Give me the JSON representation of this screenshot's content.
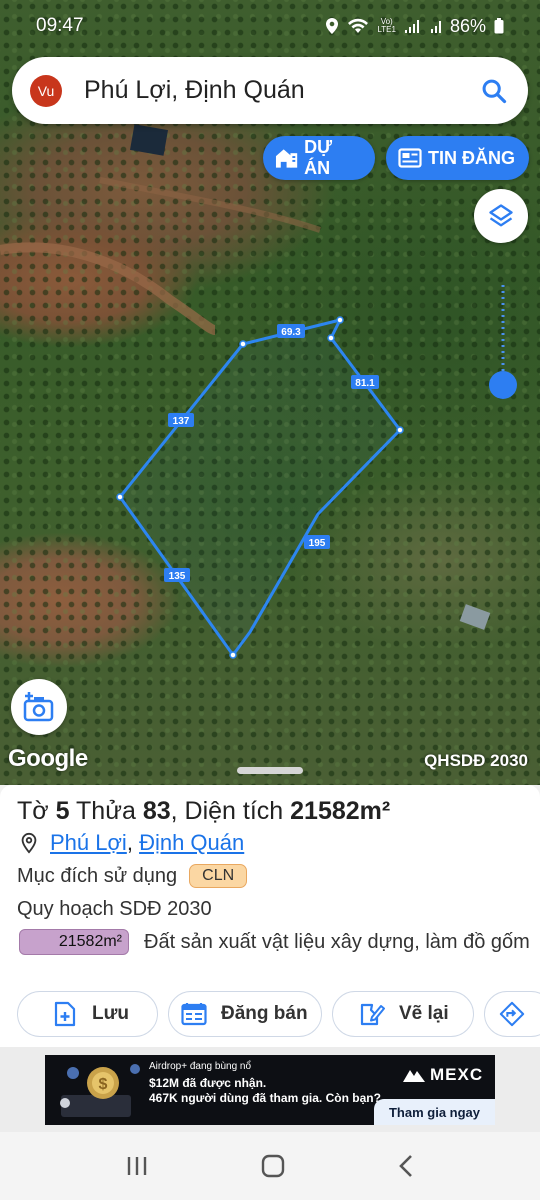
{
  "status_bar": {
    "time": "09:47",
    "battery": "86%",
    "network": "LTE1"
  },
  "search": {
    "avatar_initials": "Vu",
    "query": "Phú Lợi, Định Quán"
  },
  "chips": {
    "du_an": "DỰ ÁN",
    "tin_dang": "TIN ĐĂNG"
  },
  "map": {
    "attribution": "Google",
    "layer_label": "QHSDĐ 2030",
    "edge_labels": {
      "top": "69.3",
      "top_right": "81.1",
      "left_upper": "137",
      "right": "195",
      "left_lower": "135"
    },
    "accent_color": "#2d7ef2"
  },
  "parcel": {
    "to_label": "Tờ",
    "to_value": "5",
    "thua_label": "Thửa",
    "thua_value": "83",
    "dien_tich_label": "Diện tích",
    "dien_tich_value": "21582m²",
    "commune": "Phú Lợi",
    "district": "Định Quán",
    "separator": ",",
    "purpose_label": "Mục đích sử dụng",
    "purpose_code": "CLN",
    "plan_label": "Quy hoạch SDĐ 2030",
    "plan_area": "21582m²",
    "plan_description": "Đất sản xuất vật liệu xây dựng, làm đồ gốm"
  },
  "actions": {
    "save": "Lưu",
    "post_sale": "Đăng bán",
    "redraw": "Vẽ lại"
  },
  "ad": {
    "line1": "Airdrop+ đang bùng nổ",
    "line2": "$12M đã được nhận.",
    "line3": "467K người dùng đã tham gia. Còn bạn?",
    "brand": "MEXC",
    "cta": "Tham gia ngay"
  }
}
